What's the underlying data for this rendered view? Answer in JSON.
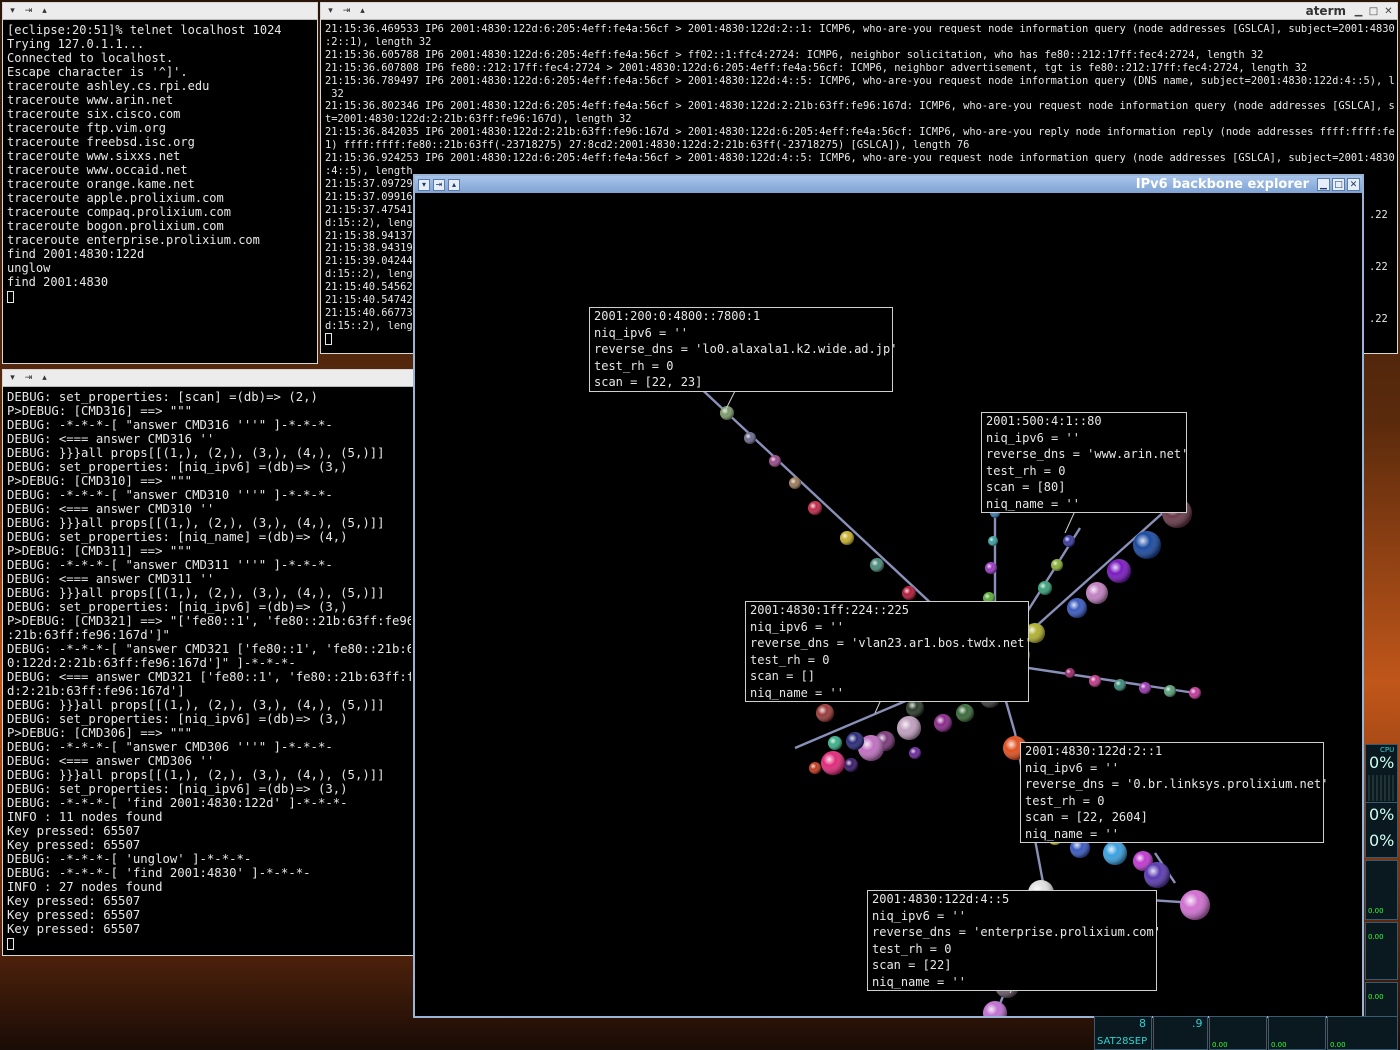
{
  "terminal_telnet": {
    "lines": [
      "[eclipse:20:51]% telnet localhost 1024",
      "Trying 127.0.1.1...",
      "Connected to localhost.",
      "Escape character is '^]'.",
      "traceroute ashley.cs.rpi.edu",
      "traceroute www.arin.net",
      "traceroute six.cisco.com",
      "traceroute ftp.vim.org",
      "traceroute freebsd.isc.org",
      "traceroute www.sixxs.net",
      "traceroute www.occaid.net",
      "traceroute orange.kame.net",
      "traceroute apple.prolixium.com",
      "traceroute compaq.prolixium.com",
      "traceroute bogon.prolixium.com",
      "traceroute enterprise.prolixium.com",
      "find 2001:4830:122d",
      "unglow",
      "find 2001:4830"
    ]
  },
  "terminal_tcpdump": {
    "title": "aterm",
    "lines": [
      "21:15:36.469533 IP6 2001:4830:122d:6:205:4eff:fe4a:56cf > 2001:4830:122d:2::1: ICMP6, who-are-you request node information query (node addresses [GSLCA], subject=2001:4830:122d",
      ":2::1), length 32",
      "21:15:36.605788 IP6 2001:4830:122d:6:205:4eff:fe4a:56cf > ff02::1:ffc4:2724: ICMP6, neighbor solicitation, who has fe80::212:17ff:fec4:2724, length 32",
      "21:15:36.607808 IP6 fe80::212:17ff:fec4:2724 > 2001:4830:122d:6:205:4eff:fe4a:56cf: ICMP6, neighbor advertisement, tgt is fe80::212:17ff:fec4:2724, length 32",
      "21:15:36.789497 IP6 2001:4830:122d:6:205:4eff:fe4a:56cf > 2001:4830:122d:4::5: ICMP6, who-are-you request node information query (DNS name, subject=2001:4830:122d:4::5), length",
      " 32",
      "21:15:36.802346 IP6 2001:4830:122d:6:205:4eff:fe4a:56cf > 2001:4830:122d:2:21b:63ff:fe96:167d: ICMP6, who-are-you request node information query (node addresses [GSLCA], subjec",
      "t=2001:4830:122d:2:21b:63ff:fe96:167d), length 32",
      "21:15:36.842035 IP6 2001:4830:122d:2:21b:63ff:fe96:167d > 2001:4830:122d:6:205:4eff:fe4a:56cf: ICMP6, who-are-you reply node information reply (node addresses ffff:ffff:fe80::(",
      "1) ffff:ffff:fe80::21b:63ff(-23718275) 27:8cd2:2001:4830:122d:2:21b:63ff(-23718275) [GSLCA]), length 76",
      "21:15:36.924253 IP6 2001:4830:122d:6:205:4eff:fe4a:56cf > 2001:4830:122d:4::5: ICMP6, who-are-you request node information query (node addresses [GSLCA], subject=2001:4830:122d",
      ":4::5), length",
      "21:15:37.09729",
      "21:15:37.09916",
      "21:15:37.47541",
      "d:15::2), lengt",
      "21:15:38.94137",
      "21:15:38.94319",
      "21:15:39.04244",
      "d:15::2), lengt",
      "21:15:40.54562",
      "21:15:40.54742",
      "21:15:40.66773",
      "d:15::2), lengt"
    ],
    "right_fragments": [
      ".22",
      ".22",
      ".22"
    ]
  },
  "terminal_debug": {
    "lines": [
      "DEBUG: set_properties: [scan] =(db)=> (2,)",
      "P>DEBUG: [CMD316] ==> \"\"\"",
      "DEBUG: -*-*-*-[ \"answer CMD316 '''\" ]-*-*-*-",
      "DEBUG: <=== answer CMD316 ''",
      "DEBUG: }}}all props[[(1,), (2,), (3,), (4,), (5,)]]",
      "DEBUG: set_properties: [niq_ipv6] =(db)=> (3,)",
      "P>DEBUG: [CMD310] ==> \"\"\"",
      "DEBUG: -*-*-*-[ \"answer CMD310 '''\" ]-*-*-*-",
      "DEBUG: <=== answer CMD310 ''",
      "DEBUG: }}}all props[[(1,), (2,), (3,), (4,), (5,)]]",
      "DEBUG: set_properties: [niq_name] =(db)=> (4,)",
      "P>DEBUG: [CMD311] ==> \"\"\"",
      "DEBUG: -*-*-*-[ \"answer CMD311 '''\" ]-*-*-*-",
      "DEBUG: <=== answer CMD311 ''",
      "DEBUG: }}}all props[[(1,), (2,), (3,), (4,), (5,)]]",
      "DEBUG: set_properties: [niq_ipv6] =(db)=> (3,)",
      "P>DEBUG: [CMD321] ==> \"['fe80::1', 'fe80::21b:63ff:fe96:16",
      ":21b:63ff:fe96:167d']\"",
      "DEBUG: -*-*-*-[ \"answer CMD321 ['fe80::1', 'fe80::21b:63ff",
      "0:122d:2:21b:63ff:fe96:167d']\" ]-*-*-*-",
      "DEBUG: <=== answer CMD321 ['fe80::1', 'fe80::21b:63ff:fe96",
      "d:2:21b:63ff:fe96:167d']",
      "DEBUG: }}}all props[[(1,), (2,), (3,), (4,), (5,)]]",
      "DEBUG: set_properties: [niq_ipv6] =(db)=> (3,)",
      "P>DEBUG: [CMD306] ==> \"\"\"",
      "DEBUG: -*-*-*-[ \"answer CMD306 '''\" ]-*-*-*-",
      "DEBUG: <=== answer CMD306 ''",
      "DEBUG: }}}all props[[(1,), (2,), (3,), (4,), (5,)]]",
      "DEBUG: set_properties: [niq_ipv6] =(db)=> (3,)",
      "DEBUG: -*-*-*-[ 'find 2001:4830:122d' ]-*-*-*-",
      "INFO : 11 nodes found",
      "Key pressed: 65507",
      "Key pressed: 65507",
      "DEBUG: -*-*-*-[ 'unglow' ]-*-*-*-",
      "DEBUG: -*-*-*-[ 'find 2001:4830' ]-*-*-*-",
      "INFO : 27 nodes found",
      "Key pressed: 65507",
      "Key pressed: 65507",
      "Key pressed: 65507"
    ]
  },
  "explorer": {
    "title": "IPv6 backbone explorer",
    "labels": [
      {
        "lines": [
          "2001:200:0:4800::7800:1",
          "niq_ipv6 = ''",
          "reverse_dns = 'lo0.alaxala1.k2.wide.ad.jp'",
          "test_rh = 0",
          "scan = [22, 23]"
        ]
      },
      {
        "lines": [
          "2001:500:4:1::80",
          "niq_ipv6 = ''",
          "reverse_dns = 'www.arin.net'",
          "test_rh = 0",
          "scan = [80]",
          "niq_name = ''"
        ]
      },
      {
        "lines": [
          "2001:4830:1ff:224::225",
          "niq_ipv6 = ''",
          "reverse_dns = 'vlan23.ar1.bos.twdx.net'",
          "test_rh = 0",
          "scan = []",
          "niq_name = ''"
        ]
      },
      {
        "lines": [
          "2001:4830:122d:2::1",
          "niq_ipv6 = ''",
          "reverse_dns = '0.br.linksys.prolixium.net'",
          "test_rh = 0",
          "scan = [22, 2604]",
          "niq_name = ''"
        ]
      },
      {
        "lines": [
          "2001:4830:122d:4::5",
          "niq_ipv6 = ''",
          "reverse_dns = 'enterprise.prolixium.com'",
          "test_rh = 0",
          "scan = [22]",
          "niq_name = ''"
        ]
      }
    ]
  },
  "dock": {
    "date_text": "SAT28SEP",
    "num_a": "8",
    "num_b": ".9",
    "cpu_label": "CPU",
    "pct_a": "0%",
    "pct_b": "0%",
    "pct_c": "0%",
    "small_vals": [
      "0.00",
      "0.00",
      "0.00",
      "0.00",
      "0.00",
      "0.00"
    ]
  },
  "colors": {
    "accent": "#9ab4d6",
    "terminal_fg": "#e8e8e8",
    "dock_text": "#2fd2d2"
  }
}
